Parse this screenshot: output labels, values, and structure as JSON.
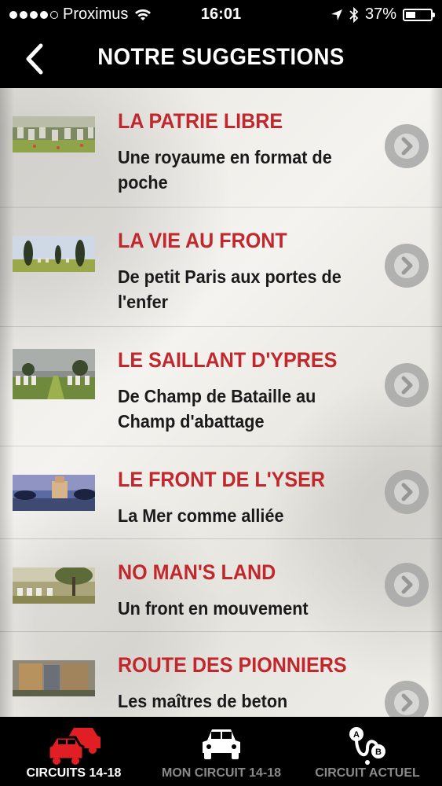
{
  "status": {
    "carrier": "Proximus",
    "time": "16:01",
    "battery": "37%",
    "battery_level": 0.37,
    "icons": [
      "signal-dots-icon",
      "wifi-icon",
      "location-arrow-icon",
      "bluetooth-icon",
      "battery-icon"
    ]
  },
  "header": {
    "title": "NOTRE SUGGESTIONS",
    "back_icon": "chevron-left-icon"
  },
  "items": [
    {
      "title": "LA PATRIE LIBRE",
      "subtitle": "Une royaume en format de poche",
      "thumb": "cemetery-graves-thumbnail"
    },
    {
      "title": "LA VIE AU FRONT",
      "subtitle": "De petit Paris aux portes de l'enfer",
      "thumb": "cypress-trees-field-thumbnail"
    },
    {
      "title": "LE SAILLANT D'YPRES",
      "subtitle": "De Champ de Bataille au Champ d'abattage",
      "thumb": "war-cemetery-rows-thumbnail"
    },
    {
      "title": "LE FRONT DE L'YSER",
      "subtitle": "La Mer comme alliée",
      "thumb": "monument-by-water-thumbnail"
    },
    {
      "title": "NO MAN'S LAND",
      "subtitle": "Un front en mouvement",
      "thumb": "tree-and-headstones-thumbnail"
    },
    {
      "title": "ROUTE DES PIONNIERS",
      "subtitle": "Les maîtres de beton",
      "thumb": "memorial-columns-thumbnail"
    }
  ],
  "tabs": [
    {
      "label": "CIRCUITS 14-18",
      "icon": "cars-icon",
      "active": true
    },
    {
      "label": "MON CIRCUIT 14-18",
      "icon": "car-icon",
      "active": false
    },
    {
      "label": "CIRCUIT ACTUEL",
      "icon": "route-a-to-b-icon",
      "active": false
    }
  ],
  "colors": {
    "accent_red": "#c1272d",
    "tab_active": "#ffffff",
    "tab_inactive": "#8a8a8a",
    "chevron_gray": "#a7a7a7"
  }
}
